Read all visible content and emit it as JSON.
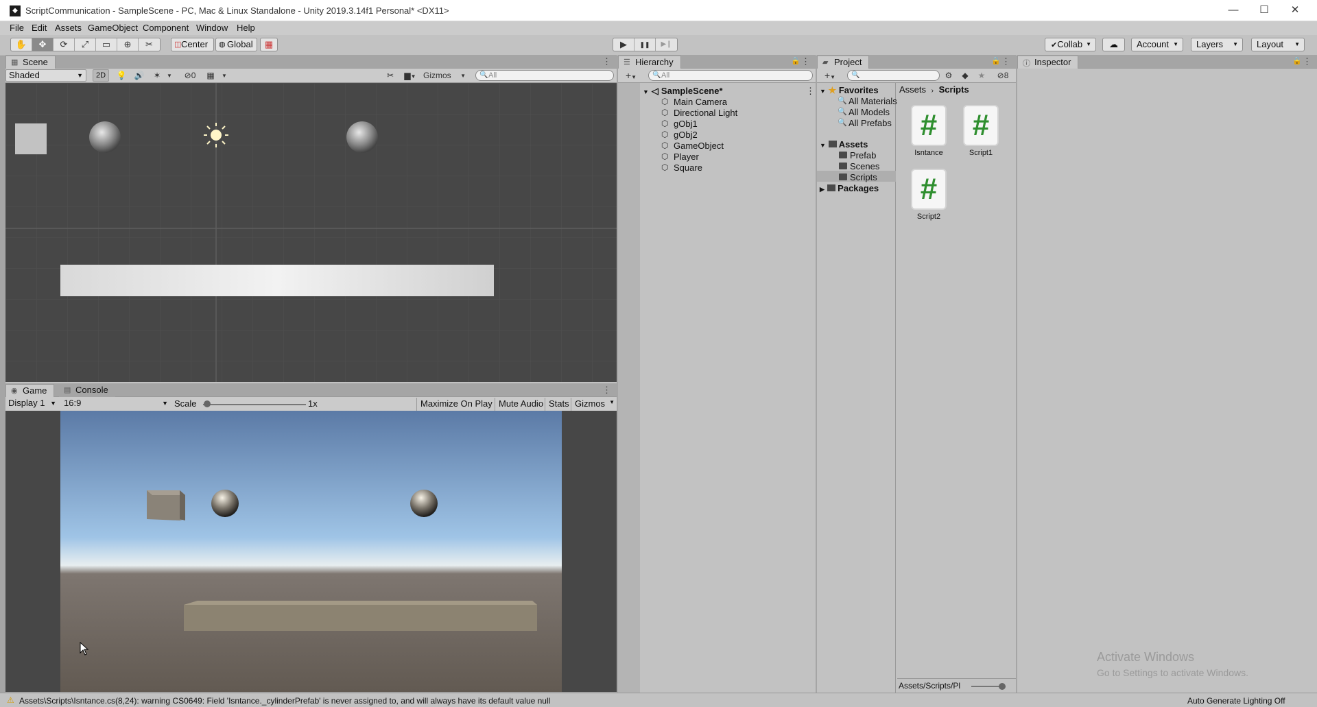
{
  "window": {
    "title": "ScriptCommunication - SampleScene - PC, Mac & Linux Standalone - Unity 2019.3.14f1 Personal* <DX11>",
    "minimize": "—",
    "maximize": "☐",
    "close": "✕"
  },
  "menu": [
    "File",
    "Edit",
    "Assets",
    "GameObject",
    "Component",
    "Window",
    "Help"
  ],
  "toolbar": {
    "tools": [
      "✋",
      "✥",
      "⟳",
      "⤢",
      "▭",
      "⊕",
      "✂"
    ],
    "pivot": "Center",
    "space": "Global",
    "play": "▶",
    "pause": "❚❚",
    "step": "▶❙",
    "collab": "Collab",
    "account": "Account",
    "layers": "Layers",
    "layout": "Layout"
  },
  "scene": {
    "tab": "Scene",
    "shading": "Shaded",
    "mode2d": "2D",
    "fx_count": "0",
    "gizmos": "Gizmos",
    "search_placeholder": "All"
  },
  "game": {
    "tab_game": "Game",
    "tab_console": "Console",
    "display": "Display 1",
    "aspect": "16:9",
    "scale_label": "Scale",
    "scale_value": "1x",
    "maximize_on_play": "Maximize On Play",
    "mute_audio": "Mute Audio",
    "stats": "Stats",
    "gizmos": "Gizmos"
  },
  "hierarchy": {
    "tab": "Hierarchy",
    "search_placeholder": "All",
    "scene_name": "SampleScene*",
    "items": [
      "Main Camera",
      "Directional Light",
      "gObj1",
      "gObj2",
      "GameObject",
      "Player",
      "Square"
    ]
  },
  "project": {
    "tab": "Project",
    "hidden_count": "8",
    "favorites_label": "Favorites",
    "favorites": [
      "All Materials",
      "All Models",
      "All Prefabs"
    ],
    "assets_label": "Assets",
    "folders": [
      "Prefab",
      "Scenes",
      "Scripts"
    ],
    "packages_label": "Packages",
    "breadcrumb": [
      "Assets",
      "Scripts"
    ],
    "files": [
      "Isntance",
      "Script1",
      "Script2"
    ],
    "footer_path": "Assets/Scripts/Pl"
  },
  "inspector": {
    "tab": "Inspector"
  },
  "watermark": {
    "line1": "Activate Windows",
    "line2": "Go to Settings to activate Windows."
  },
  "status": {
    "warning": "Assets\\Scripts\\Isntance.cs(8,24): warning CS0649: Field 'Isntance._cylinderPrefab' is never assigned to, and will always have its default value null",
    "lighting": "Auto Generate Lighting Off"
  }
}
